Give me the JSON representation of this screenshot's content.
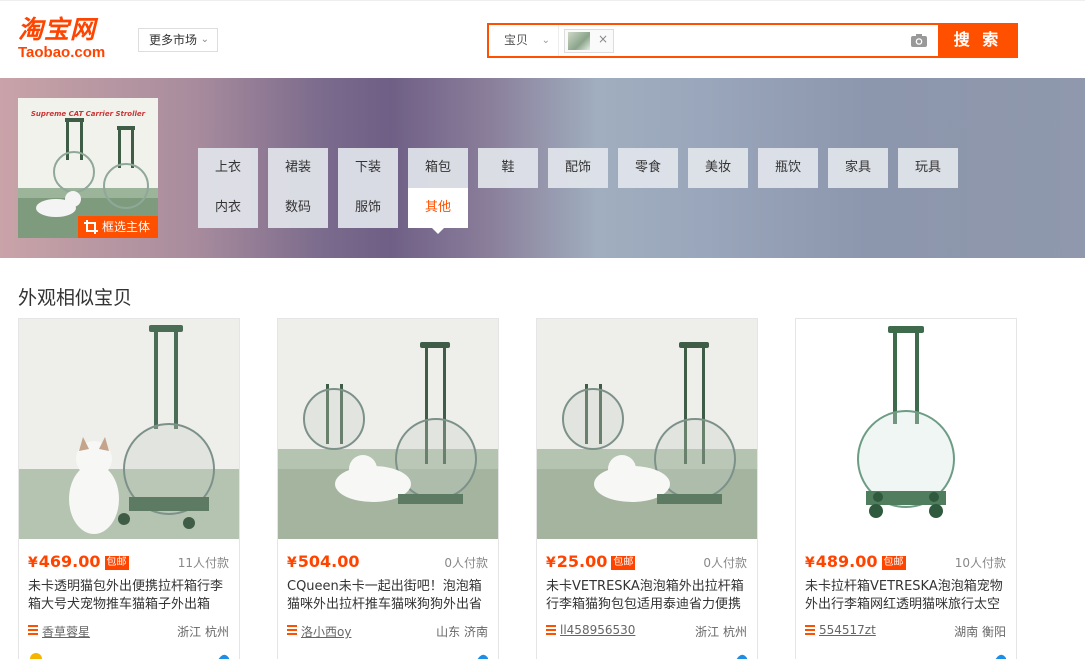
{
  "header": {
    "logo_cn": "淘宝网",
    "logo_en": "Taobao.com",
    "market_label": "更多市场"
  },
  "search": {
    "scope": "宝贝",
    "button_label": "搜 索"
  },
  "banner": {
    "image_caption": "Supreme CAT Carrier Stroller",
    "frame_button": "框选主体",
    "categories": [
      "上衣",
      "裙装",
      "下装",
      "箱包",
      "鞋",
      "配饰",
      "零食",
      "美妆",
      "瓶饮",
      "家具",
      "玩具",
      "内衣",
      "数码",
      "服饰",
      "其他"
    ],
    "active_category": "其他"
  },
  "section_title": "外观相似宝贝",
  "products": [
    {
      "currency": "¥",
      "price": "469.00",
      "baoyou": "包邮",
      "sold": "11人付款",
      "title": "未卡透明猫包外出便携拉杆箱行李箱大号犬宠物推车猫箱子外出箱",
      "shop": "香草蓉星",
      "location": "浙江 杭州"
    },
    {
      "currency": "¥",
      "price": "504.00",
      "baoyou": "",
      "sold": "0人付款",
      "title": "CQueen未卡一起出街吧！泡泡箱猫咪外出拉杆推车猫咪狗狗外出省力",
      "shop": "洛小西oy",
      "location": "山东 济南"
    },
    {
      "currency": "¥",
      "price": "25.00",
      "baoyou": "包邮",
      "sold": "0人付款",
      "title": "未卡VETRESKA泡泡箱外出拉杆箱行李箱猫狗包包适用泰迪省力便携",
      "shop": "ll458956530",
      "location": "浙江 杭州"
    },
    {
      "currency": "¥",
      "price": "489.00",
      "baoyou": "包邮",
      "sold": "10人付款",
      "title": "未卡拉杆箱VETRESKA泡泡箱宠物外出行李箱网红透明猫咪旅行太空包",
      "shop": "554517zt",
      "location": "湖南 衡阳"
    }
  ],
  "colors": {
    "accent": "#ff5000",
    "price": "#ff4400"
  }
}
